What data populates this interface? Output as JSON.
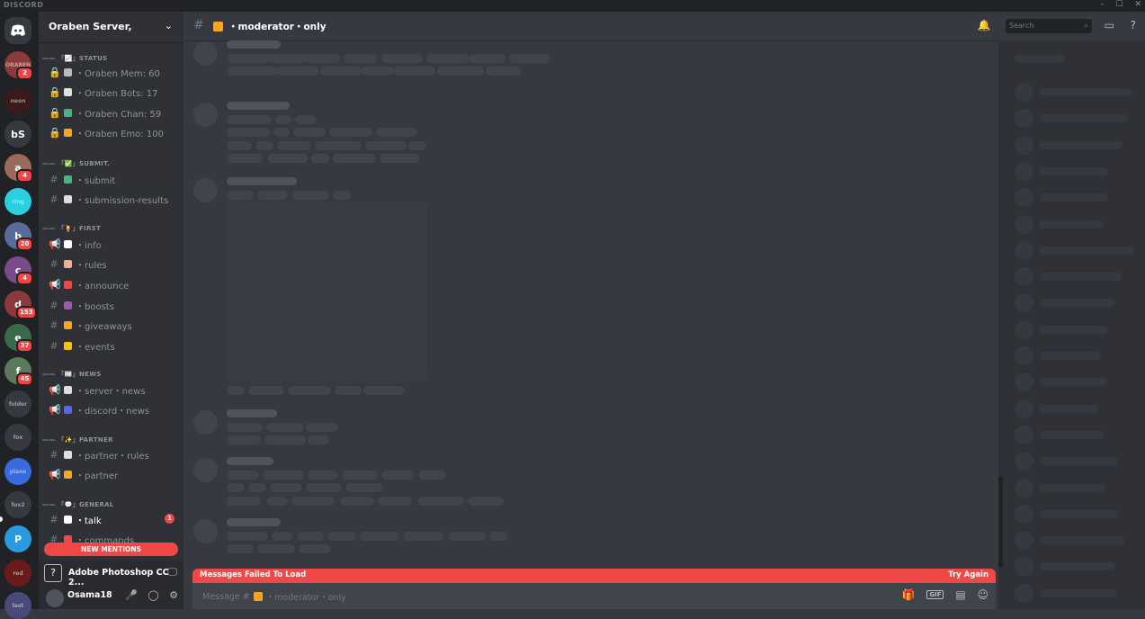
{
  "app": {
    "brand": "DISCORD",
    "window_controls": [
      "–",
      "☐",
      "✕"
    ]
  },
  "servers": [
    {
      "name": "ORABEN",
      "color": "#8b3a3a",
      "badge": "2"
    },
    {
      "name": "neon",
      "color": "#3a1a1a",
      "badge": ""
    },
    {
      "name": "bS",
      "color": "#36393f",
      "badge": ""
    },
    {
      "name": "a",
      "color": "#9a6a5a",
      "badge": "4"
    },
    {
      "name": "ring",
      "color": "#2ad0e0",
      "badge": ""
    },
    {
      "name": "b",
      "color": "#5a6a9a",
      "badge": "20"
    },
    {
      "name": "c",
      "color": "#7a4a8a",
      "badge": "4"
    },
    {
      "name": "d",
      "color": "#8a3a3a",
      "badge": "153"
    },
    {
      "name": "e",
      "color": "#3a6a4a",
      "badge": "37"
    },
    {
      "name": "f",
      "color": "#5a7a5a",
      "badge": "45"
    },
    {
      "name": "folder",
      "color": "#36393f",
      "badge": ""
    },
    {
      "name": "fox",
      "color": "#36393f",
      "badge": ""
    },
    {
      "name": "plane",
      "color": "#3a6adf",
      "badge": ""
    },
    {
      "name": "fox2",
      "color": "#36393f",
      "badge": ""
    },
    {
      "name": "P",
      "color": "#2a9ae0",
      "badge": ""
    },
    {
      "name": "red",
      "color": "#6a1a1a",
      "badge": ""
    },
    {
      "name": "last",
      "color": "#4a4a7a",
      "badge": ""
    }
  ],
  "sidebar": {
    "server_name": "Oraben Server,",
    "categories": [
      {
        "label": "—— 「📈」STATUS",
        "channels": [
          {
            "prefix": "🔒",
            "emoji_color": "#b9bbbe",
            "name": "・Oraben Mem: 60"
          },
          {
            "prefix": "🔒",
            "emoji_color": "#e0e0e0",
            "name": "・Oraben Bots: 17"
          },
          {
            "prefix": "🔒",
            "emoji_color": "#43b581",
            "name": "・Oraben Chan: 59"
          },
          {
            "prefix": "🔒",
            "emoji_color": "#faa61a",
            "name": "・Oraben Emo: 100"
          }
        ]
      },
      {
        "label": "—— 「✅」SUBMIT.",
        "channels": [
          {
            "prefix": "#",
            "emoji_color": "#43b581",
            "name": "・submit"
          },
          {
            "prefix": "#",
            "emoji_color": "#dcddde",
            "name": "・submission-results"
          }
        ]
      },
      {
        "label": "—— 「🍹」FIRST",
        "channels": [
          {
            "prefix": "📢",
            "emoji_color": "#ffffff",
            "name": "・info"
          },
          {
            "prefix": "#",
            "emoji_color": "#f0b090",
            "name": "・rules"
          },
          {
            "prefix": "📢",
            "emoji_color": "#f04747",
            "name": "・announce"
          },
          {
            "prefix": "#",
            "emoji_color": "#9b59b6",
            "name": "・boosts"
          },
          {
            "prefix": "#",
            "emoji_color": "#faa61a",
            "name": "・giveaways"
          },
          {
            "prefix": "#",
            "emoji_color": "#f1c40f",
            "name": "・events"
          }
        ]
      },
      {
        "label": "—— 「📰」NEWS",
        "channels": [
          {
            "prefix": "📢",
            "emoji_color": "#dcddde",
            "name": "・server・news"
          },
          {
            "prefix": "📢",
            "emoji_color": "#5865f2",
            "name": "・discord・news"
          }
        ]
      },
      {
        "label": "—— 「✨」PARTNER",
        "channels": [
          {
            "prefix": "#",
            "emoji_color": "#dcddde",
            "name": "・partner・rules"
          },
          {
            "prefix": "📢",
            "emoji_color": "#faa61a",
            "name": "・partner"
          }
        ]
      },
      {
        "label": "—— 「💬」GENERAL",
        "channels": [
          {
            "prefix": "#",
            "emoji_color": "#ffffff",
            "name": "・talk",
            "badge": "1"
          },
          {
            "prefix": "#",
            "emoji_color": "#f04747",
            "name": "・commands"
          },
          {
            "prefix": "#",
            "emoji_color": "#f04747",
            "name": "・feelings"
          }
        ]
      }
    ],
    "new_mentions": "NEW MENTIONS",
    "activity": "Adobe Photoshop CC 2...",
    "username": "Osama18"
  },
  "header": {
    "channel_name": "・moderator・only",
    "search_placeholder": "Search"
  },
  "chat": {
    "fail_message": "Messages Failed To Load",
    "retry": "Try Again",
    "input_placeholder_prefix": "Message #",
    "input_placeholder_channel": "・moderator・only"
  },
  "colors": {
    "accent": "#f04747",
    "bg": "#36393f",
    "sidebar": "#2f3136",
    "rail": "#202225"
  }
}
